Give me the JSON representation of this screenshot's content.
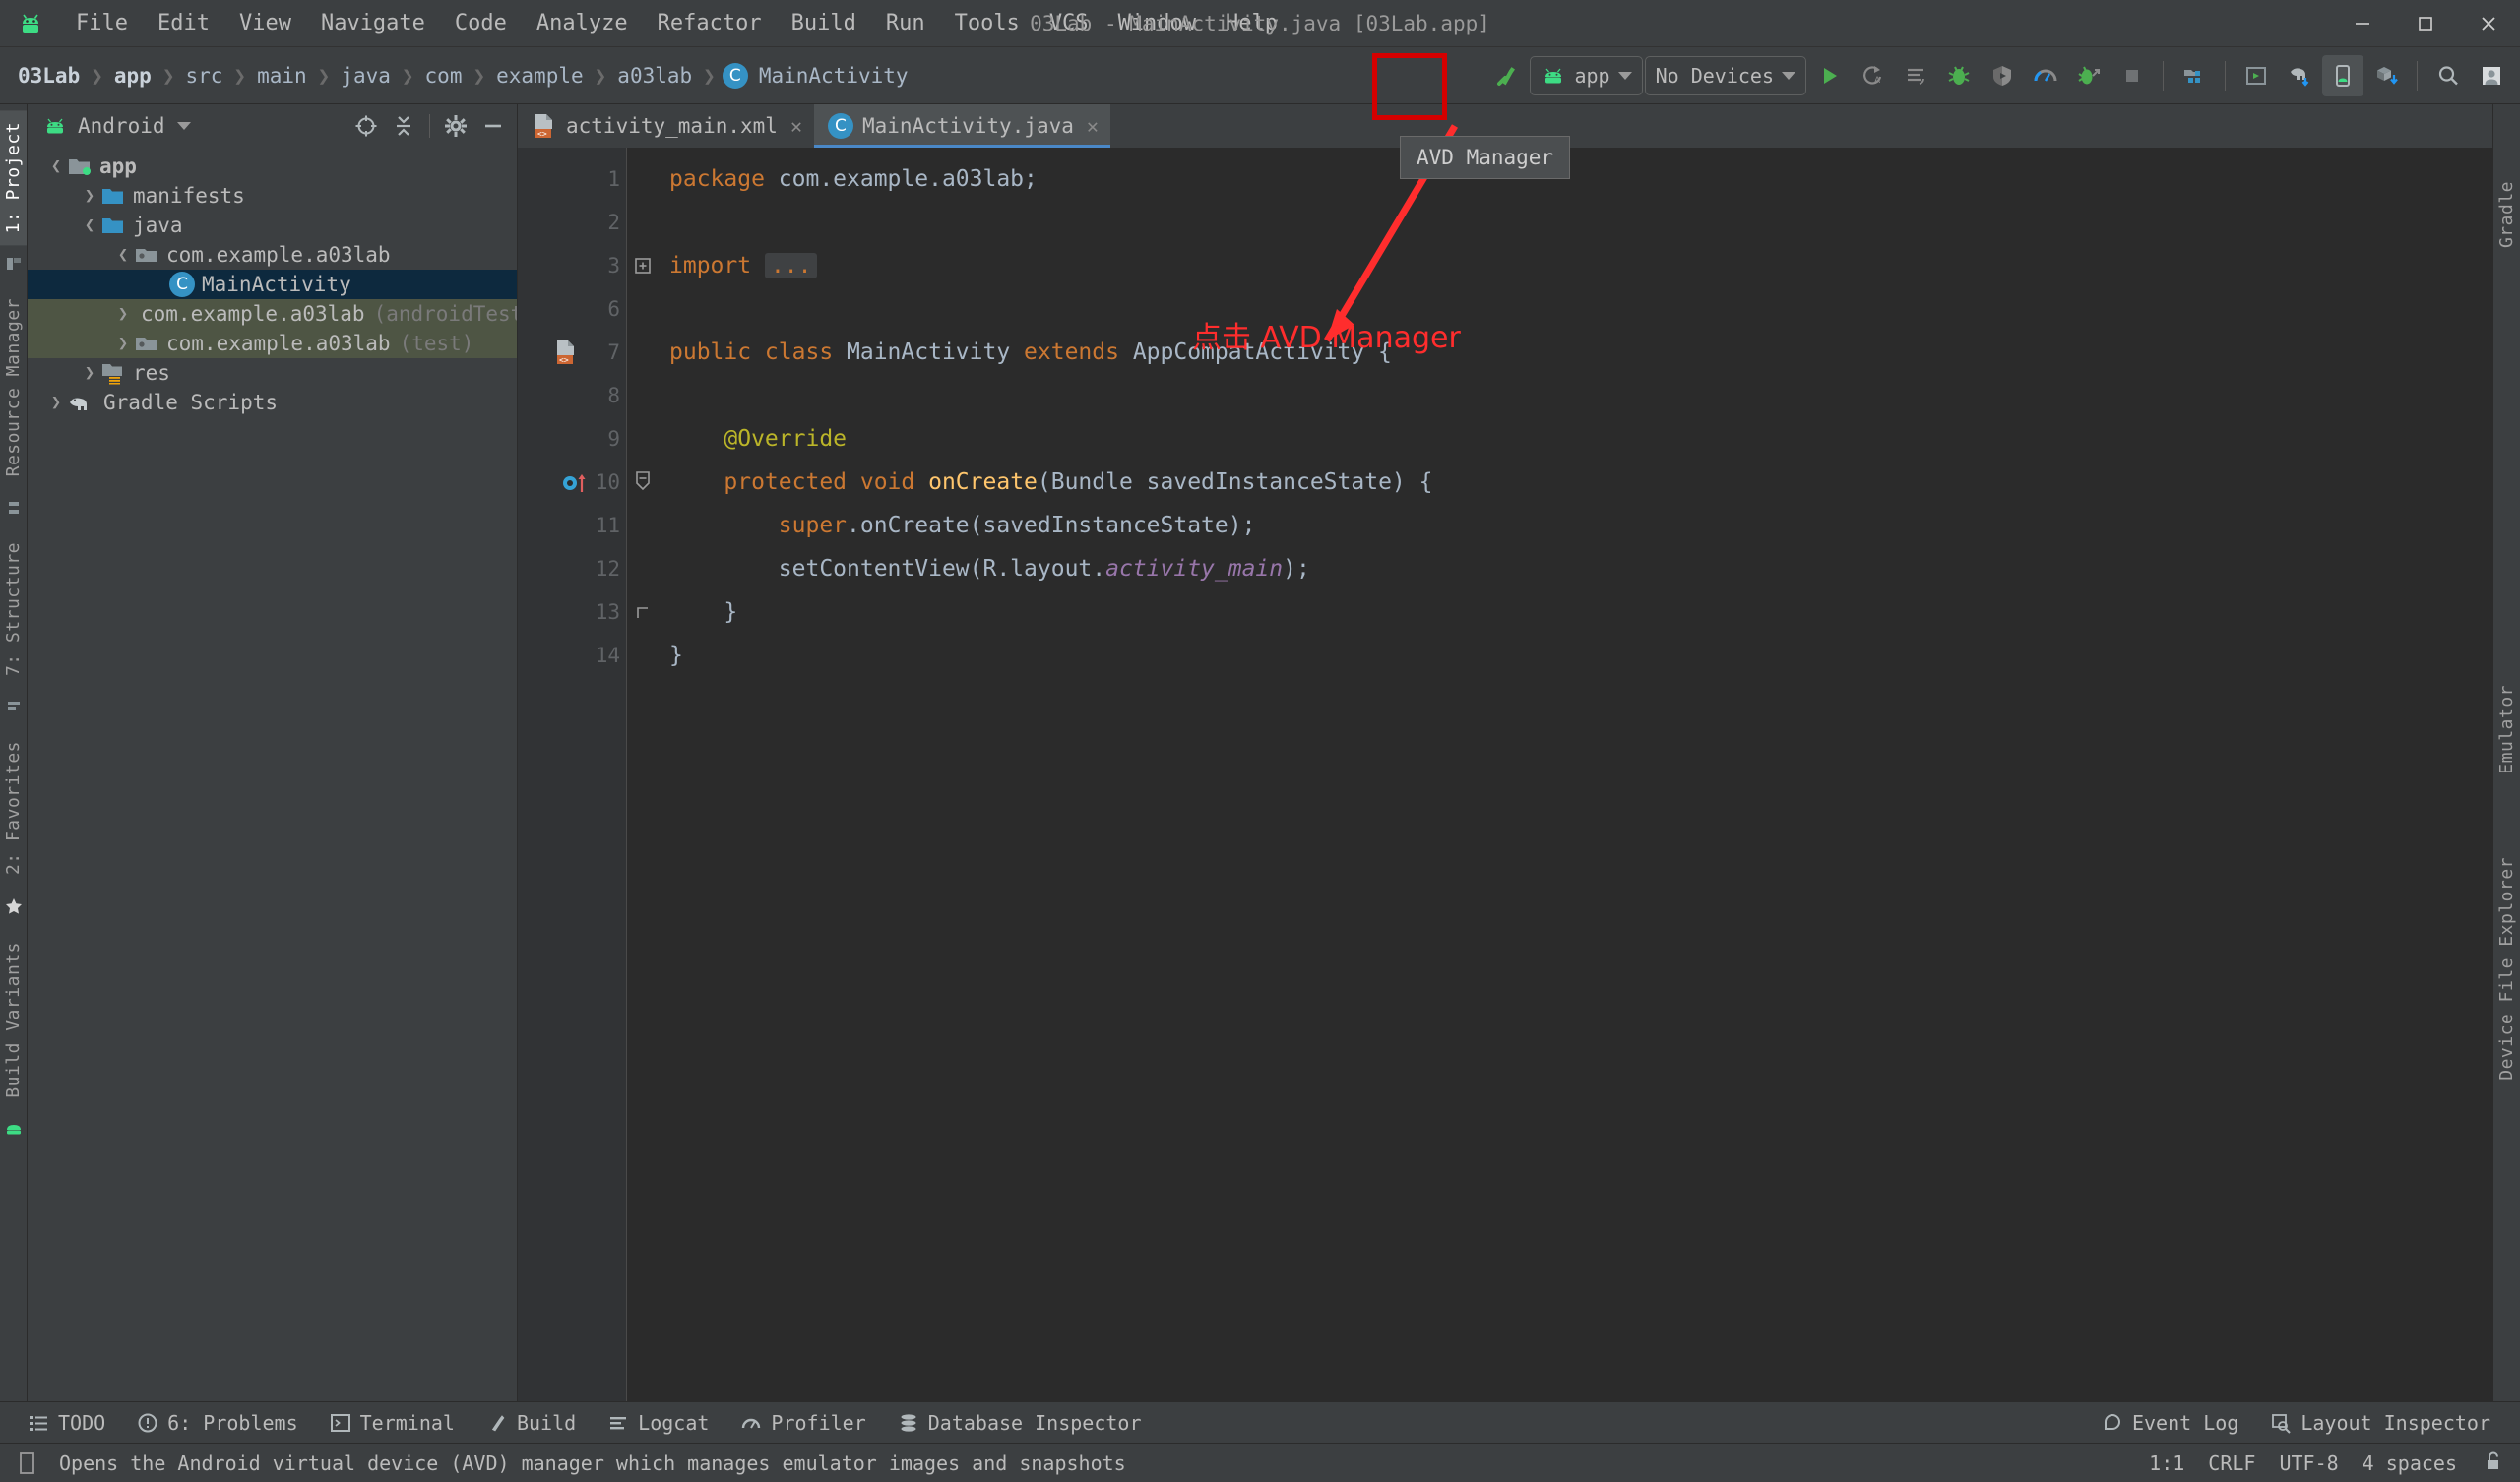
{
  "window": {
    "title": "03Lab - MainActivity.java [03Lab.app]",
    "minimize_icon": "minimize-icon",
    "maximize_icon": "maximize-icon",
    "close_icon": "close-icon"
  },
  "menu": {
    "logo_icon": "android-logo-icon",
    "items": [
      "File",
      "Edit",
      "View",
      "Navigate",
      "Code",
      "Analyze",
      "Refactor",
      "Build",
      "Run",
      "Tools",
      "VCS",
      "Window",
      "Help"
    ]
  },
  "breadcrumb": {
    "items": [
      "03Lab",
      "app",
      "src",
      "main",
      "java",
      "com",
      "example",
      "a03lab"
    ],
    "leaf": "MainActivity",
    "leaf_icon_letter": "C"
  },
  "toolbar": {
    "build_icon": "build-hammer-icon",
    "module_combo": {
      "label": "app",
      "icon": "android-head-icon"
    },
    "device_combo": {
      "label": "No Devices"
    },
    "run_icon": "run-icon",
    "rerun_icon": "apply-changes-rerun-icon",
    "restart_icon": "apply-code-changes-icon",
    "debug_icon": "debug-bug-icon",
    "attach_debugger_icon": "attach-debugger-icon",
    "profiler_icon": "profiler-icon",
    "run_anything_icon": "run-with-coverage-icon",
    "stop_icon": "stop-icon",
    "sdk_manager_icon": "sdk-manager-icon",
    "layout_editor_icon": "layout-editor-icon",
    "gradle_sync_icon": "gradle-sync-elephant-icon",
    "avd_manager_icon": "avd-manager-icon",
    "sdk_download_icon": "sdk-download-icon",
    "search_icon": "search-everywhere-icon",
    "account_icon": "user-account-icon"
  },
  "project_panel": {
    "title": "Android",
    "view_icon": "android-head-icon",
    "dropdown_icon": "chevron-down-icon",
    "tools": [
      "select-opened-file-icon",
      "collapse-all-icon",
      "settings-gear-icon",
      "hide-panel-icon"
    ],
    "tree": [
      {
        "label": "app",
        "indent": 0,
        "arrow": "expanded",
        "icon": "module-folder-icon",
        "bold": true,
        "style": "normal"
      },
      {
        "label": "manifests",
        "indent": 1,
        "arrow": "collapsed",
        "icon": "folder-icon",
        "bold": false,
        "style": "normal"
      },
      {
        "label": "java",
        "indent": 1,
        "arrow": "expanded",
        "icon": "folder-icon",
        "bold": false,
        "style": "normal"
      },
      {
        "label": "com.example.a03lab",
        "indent": 2,
        "arrow": "expanded",
        "icon": "package-folder-icon",
        "bold": false,
        "style": "normal"
      },
      {
        "label": "MainActivity",
        "indent": 3,
        "arrow": "none",
        "icon": "java-class-icon",
        "bold": false,
        "style": "selected"
      },
      {
        "label": "com.example.a03lab",
        "suffix": "(androidTest)",
        "indent": 2,
        "arrow": "collapsed",
        "icon": "package-folder-icon",
        "bold": false,
        "style": "test"
      },
      {
        "label": "com.example.a03lab",
        "suffix": "(test)",
        "indent": 2,
        "arrow": "collapsed",
        "icon": "package-folder-icon",
        "bold": false,
        "style": "test"
      },
      {
        "label": "res",
        "indent": 1,
        "arrow": "collapsed",
        "icon": "res-folder-icon",
        "bold": false,
        "style": "normal"
      },
      {
        "label": "Gradle Scripts",
        "indent": 0,
        "arrow": "collapsed",
        "icon": "gradle-elephant-icon",
        "bold": false,
        "style": "normal"
      }
    ]
  },
  "editor": {
    "tabs": [
      {
        "label": "activity_main.xml",
        "icon": "xml-layout-file-icon",
        "active": false
      },
      {
        "label": "MainActivity.java",
        "icon": "java-class-icon",
        "active": true
      }
    ],
    "close_icon": "close-tab-icon",
    "lines": [
      {
        "num": "1",
        "gutter": "",
        "fold": "",
        "tokens": [
          {
            "t": "package ",
            "c": "kw"
          },
          {
            "t": "com.example.a03lab;",
            "c": "id"
          }
        ]
      },
      {
        "num": "2",
        "gutter": "",
        "fold": "",
        "tokens": []
      },
      {
        "num": "3",
        "gutter": "",
        "fold": "plus",
        "tokens": [
          {
            "t": "import ",
            "c": "kw"
          },
          {
            "t": "...",
            "c": "dots"
          }
        ]
      },
      {
        "num": "6",
        "gutter": "",
        "fold": "",
        "tokens": []
      },
      {
        "num": "7",
        "gutter": "layout-file-marker",
        "fold": "",
        "tokens": [
          {
            "t": "public class ",
            "c": "kw"
          },
          {
            "t": "MainActivity ",
            "c": "id"
          },
          {
            "t": "extends ",
            "c": "kw"
          },
          {
            "t": "AppCompatActivity {",
            "c": "id"
          }
        ]
      },
      {
        "num": "8",
        "gutter": "",
        "fold": "",
        "tokens": []
      },
      {
        "num": "9",
        "gutter": "",
        "fold": "",
        "tokens": [
          {
            "t": "    @Override",
            "c": "anno"
          }
        ]
      },
      {
        "num": "10",
        "gutter": "override-method-marker",
        "fold": "minus",
        "tokens": [
          {
            "t": "    ",
            "c": "id"
          },
          {
            "t": "protected void ",
            "c": "kw"
          },
          {
            "t": "onCreate",
            "c": "meth"
          },
          {
            "t": "(Bundle savedInstanceState) {",
            "c": "id"
          }
        ]
      },
      {
        "num": "11",
        "gutter": "",
        "fold": "",
        "tokens": [
          {
            "t": "        ",
            "c": "id"
          },
          {
            "t": "super",
            "c": "kw"
          },
          {
            "t": ".onCreate(savedInstanceState);",
            "c": "id"
          }
        ]
      },
      {
        "num": "12",
        "gutter": "",
        "fold": "",
        "tokens": [
          {
            "t": "        setContentView(R.layout.",
            "c": "id"
          },
          {
            "t": "activity_main",
            "c": "fld"
          },
          {
            "t": ");",
            "c": "id"
          }
        ]
      },
      {
        "num": "13",
        "gutter": "",
        "fold": "end",
        "tokens": [
          {
            "t": "    }",
            "c": "id"
          }
        ]
      },
      {
        "num": "14",
        "gutter": "",
        "fold": "",
        "tokens": [
          {
            "t": "}",
            "c": "id"
          }
        ]
      }
    ]
  },
  "left_strip": {
    "tabs": [
      "1: Project",
      "Resource Manager",
      "7: Structure",
      "2: Favorites",
      "Build Variants"
    ],
    "icons": [
      "project-files-icon",
      "structure-icon",
      "favorites-star-icon",
      "build-variants-icon",
      "android-bottom-icon"
    ]
  },
  "right_strip": {
    "tabs": [
      "Gradle",
      "Emulator",
      "Device File Explorer"
    ]
  },
  "bottom_tools": {
    "items": [
      {
        "label": "TODO",
        "icon": "todo-list-icon"
      },
      {
        "label": "6: Problems",
        "icon": "problems-warning-icon"
      },
      {
        "label": "Terminal",
        "icon": "terminal-icon"
      },
      {
        "label": "Build",
        "icon": "build-hammer-icon"
      },
      {
        "label": "Logcat",
        "icon": "logcat-icon"
      },
      {
        "label": "Profiler",
        "icon": "profiler-icon"
      },
      {
        "label": "Database Inspector",
        "icon": "database-icon"
      }
    ],
    "right_items": [
      {
        "label": "Event Log",
        "icon": "event-log-icon"
      },
      {
        "label": "Layout Inspector",
        "icon": "layout-inspector-icon"
      }
    ]
  },
  "status_bar": {
    "icon": "status-hint-icon",
    "message": "Opens the Android virtual device (AVD) manager which manages emulator images and snapshots",
    "caret_position": "1:1",
    "line_separator": "CRLF",
    "encoding": "UTF-8",
    "indent": "4 spaces",
    "lock_icon": "unlocked-padlock-icon"
  },
  "annotations": {
    "tooltip_text": "AVD Manager",
    "callout_text": "点击 AVD Manager",
    "highlight_color": "#d40000",
    "arrow_color": "#ff2d2d"
  }
}
